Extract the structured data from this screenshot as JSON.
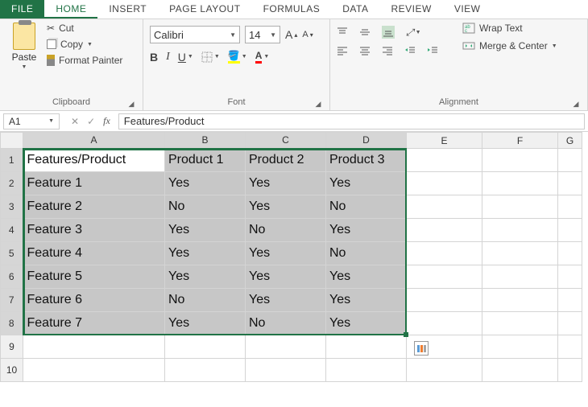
{
  "tabs": {
    "file": "FILE",
    "home": "HOME",
    "insert": "INSERT",
    "pageLayout": "PAGE LAYOUT",
    "formulas": "FORMULAS",
    "data": "DATA",
    "review": "REVIEW",
    "view": "VIEW"
  },
  "ribbon": {
    "clipboard": {
      "label": "Clipboard",
      "paste": "Paste",
      "cut": "Cut",
      "copy": "Copy",
      "formatPainter": "Format Painter"
    },
    "font": {
      "label": "Font",
      "name": "Calibri",
      "size": "14",
      "bold": "B",
      "italic": "I",
      "underline": "U"
    },
    "alignment": {
      "label": "Alignment",
      "wrapText": "Wrap Text",
      "mergeCenter": "Merge & Center"
    }
  },
  "formulaBar": {
    "nameBox": "A1",
    "formula": "Features/Product"
  },
  "grid": {
    "columns": [
      "A",
      "B",
      "C",
      "D",
      "E",
      "F",
      "G"
    ],
    "rows": [
      "1",
      "2",
      "3",
      "4",
      "5",
      "6",
      "7",
      "8",
      "9",
      "10"
    ],
    "data": [
      [
        "Features/Product",
        "Product 1",
        "Product 2",
        "Product 3",
        "",
        "",
        ""
      ],
      [
        "Feature 1",
        "Yes",
        "Yes",
        "Yes",
        "",
        "",
        ""
      ],
      [
        "Feature 2",
        "No",
        "Yes",
        "No",
        "",
        "",
        ""
      ],
      [
        "Feature 3",
        "Yes",
        "No",
        "Yes",
        "",
        "",
        ""
      ],
      [
        "Feature 4",
        "Yes",
        "Yes",
        "No",
        "",
        "",
        ""
      ],
      [
        "Feature 5",
        "Yes",
        "Yes",
        "Yes",
        "",
        "",
        ""
      ],
      [
        "Feature 6",
        "No",
        "Yes",
        "Yes",
        "",
        "",
        ""
      ],
      [
        "Feature 7",
        "Yes",
        "No",
        "Yes",
        "",
        "",
        ""
      ],
      [
        "",
        "",
        "",
        "",
        "",
        "",
        ""
      ],
      [
        "",
        "",
        "",
        "",
        "",
        "",
        ""
      ]
    ],
    "selection": {
      "r1": 1,
      "c1": 1,
      "r2": 8,
      "c2": 4
    }
  }
}
